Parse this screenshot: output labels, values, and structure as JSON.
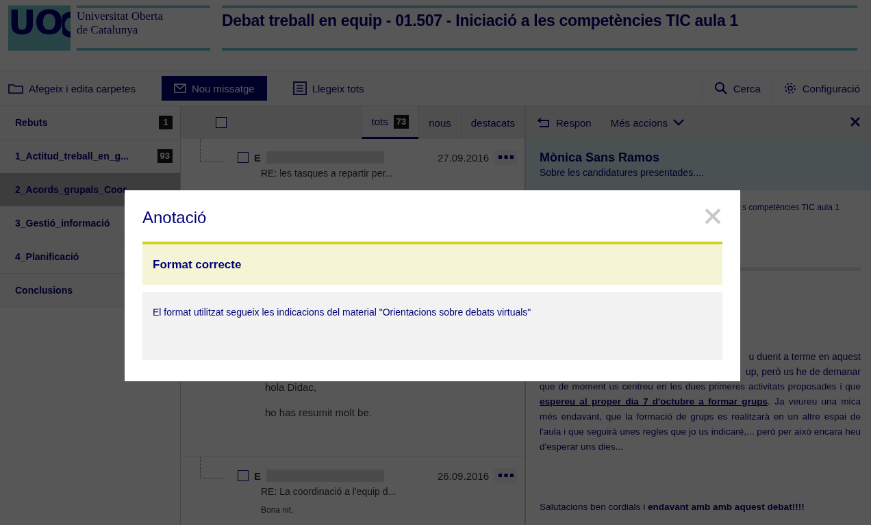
{
  "header": {
    "logo_text": "UO",
    "university": [
      "Universitat Oberta",
      "de Catalunya"
    ],
    "title": "Debat treball en equip - 01.507 - Iniciació a les competències TIC aula 1"
  },
  "toolbar": {
    "left": [
      {
        "kind": "folder",
        "label": "Afegeix i edita carpetes"
      },
      {
        "kind": "primary",
        "label": "Nou missatge"
      },
      {
        "kind": "list",
        "label": "Llegeix tots"
      }
    ],
    "right": [
      {
        "kind": "search",
        "label": "Cerca"
      },
      {
        "kind": "gear",
        "label": "Configuració"
      }
    ]
  },
  "folders": [
    {
      "name": "Rebuts",
      "count": "1",
      "selected": false
    },
    {
      "name": "1_Actitud_treball_en_g...",
      "count": "93",
      "selected": false
    },
    {
      "name": "2_Acords_grupals_Coor",
      "selected": true
    },
    {
      "name": "3_Gestió_informació",
      "selected": false
    },
    {
      "name": "4_Planificació",
      "selected": false
    },
    {
      "name": "Conclusions",
      "selected": false
    }
  ],
  "list": {
    "select_all": {
      "checked": false
    },
    "tabs": [
      {
        "label": "tots",
        "count": "73",
        "selected": true
      },
      {
        "label": "nous",
        "selected": false
      },
      {
        "label": "destacats",
        "selected": false
      }
    ],
    "items": [
      {
        "kind": "header",
        "initial": "E",
        "date": "27.09.2016",
        "subject": "RE: les tasques a repartir per...",
        "checked": false
      },
      {
        "kind": "body",
        "paragraphs": [
          "hola Didac,",
          "ho has resumit molt be."
        ]
      },
      {
        "kind": "header",
        "initial": "E",
        "date": "26.09.2016",
        "subject": "RE: La coordinació a l'equip d...",
        "preview": "Bona nit,",
        "checked": false
      }
    ]
  },
  "reader": {
    "actions": [
      {
        "kind": "reply",
        "label": "Respon"
      },
      {
        "kind": "more",
        "label": "Més accions"
      }
    ],
    "sender": "Mònica Sans Ramos",
    "subject": "Sobre les candidatures presentades....",
    "course_fragment": "s competències TIC aula 1",
    "line_fragments": [
      "u duent a terme en aquest",
      "up, però us he de demanar"
    ],
    "paragraphs": [
      {
        "kind": "underline",
        "text": "que de moment us centreu en les dues primeres activitats proposades i que **espereu al proper dia 7 d'octubre a formar grups**. Ja veureu una mica més endavant, que la formació de grups es realitzarà en un altre espai de l'aula i que seguirà unes regles que jo us indicaré,... però per això encara heu d'esperar uns dies..."
      },
      {
        "kind": "plain",
        "text": "Salutacions ben cordials i **endavant amb amb aquest debat!!!!**"
      }
    ]
  },
  "modal": {
    "title": "Anotació",
    "heading": "Format correcte",
    "text": "El format utilitzat segueix les indicacions del material \"Orientacions sobre debats virtuals\""
  }
}
